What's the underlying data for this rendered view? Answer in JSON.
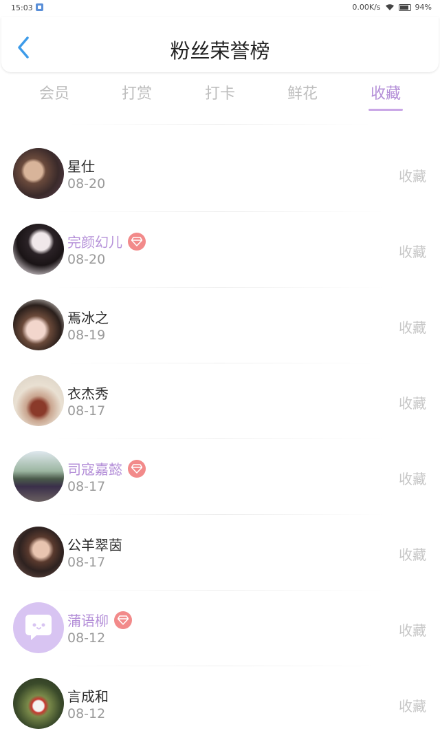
{
  "status_bar": {
    "time": "15:03",
    "network_speed": "0.00K/s",
    "battery": "94%"
  },
  "header": {
    "title": "粉丝荣誉榜",
    "back_icon": "chevron-left-icon",
    "accent_color": "#3d9be9"
  },
  "tabs": [
    {
      "label": "会员",
      "active": false
    },
    {
      "label": "打赏",
      "active": false
    },
    {
      "label": "打卡",
      "active": false
    },
    {
      "label": "鲜花",
      "active": false
    },
    {
      "label": "收藏",
      "active": true
    }
  ],
  "colors": {
    "active_tab": "#b48fd8",
    "inactive_tab": "#bdbdbd",
    "vip_name": "#b48fd8",
    "vip_badge": "#f28a8a"
  },
  "fans": [
    {
      "name": "星仕",
      "date": "08-20",
      "action": "收藏",
      "vip": false
    },
    {
      "name": "完颜幻儿",
      "date": "08-20",
      "action": "收藏",
      "vip": true
    },
    {
      "name": "焉冰之",
      "date": "08-19",
      "action": "收藏",
      "vip": false
    },
    {
      "name": "衣杰秀",
      "date": "08-17",
      "action": "收藏",
      "vip": false
    },
    {
      "name": "司寇嘉懿",
      "date": "08-17",
      "action": "收藏",
      "vip": true
    },
    {
      "name": "公羊翠茵",
      "date": "08-17",
      "action": "收藏",
      "vip": false
    },
    {
      "name": "蒲语柳",
      "date": "08-12",
      "action": "收藏",
      "vip": true
    },
    {
      "name": "言成和",
      "date": "08-12",
      "action": "收藏",
      "vip": false
    }
  ]
}
